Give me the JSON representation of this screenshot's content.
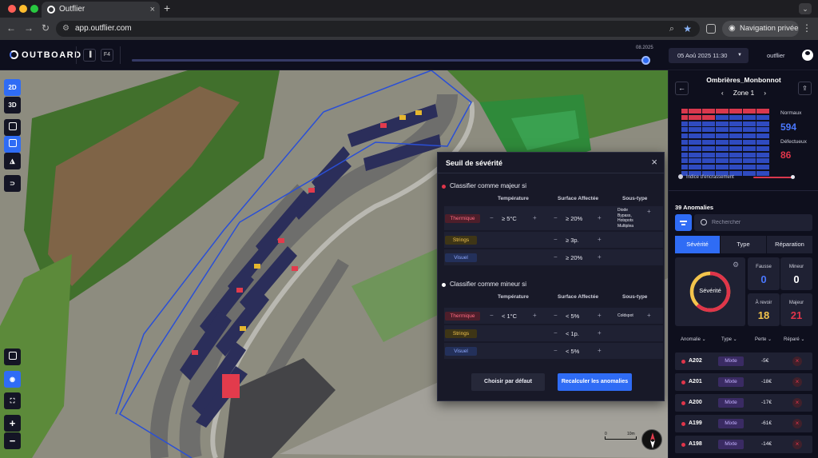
{
  "browser": {
    "tab_title": "Outflier",
    "url": "app.outflier.com",
    "private_label": "Navigation privée",
    "colors": {
      "red": "#ff5f57",
      "yellow": "#febc2e",
      "green": "#28c840"
    }
  },
  "header": {
    "brand": "OUTBOARD",
    "icon_b_label": "F4",
    "timeline_label": "08.2025",
    "timeline_progress": 1.0,
    "date": "05 Aoû 2025 11:30",
    "user": "outflier"
  },
  "left_tools": [
    {
      "label": "2D",
      "icon": "2d-view-icon",
      "active": true
    },
    {
      "label": "3D",
      "icon": "3d-view-icon",
      "active": false
    },
    {
      "label": "",
      "icon": "layers-icon",
      "active": false
    },
    {
      "label": "",
      "icon": "grid-icon",
      "active": true
    },
    {
      "label": "",
      "icon": "drone-icon",
      "active": false
    },
    {
      "label": "",
      "icon": "path-icon",
      "active": false
    }
  ],
  "left_tools_bottom": [
    {
      "label": "",
      "icon": "panel-icon",
      "active": false
    },
    {
      "label": "",
      "icon": "eye-icon",
      "active": true
    },
    {
      "label": "",
      "icon": "fullscreen-icon",
      "active": false
    },
    {
      "label": "+",
      "icon": "zoom-in-icon",
      "active": false
    },
    {
      "label": "−",
      "icon": "zoom-out-icon",
      "active": false
    }
  ],
  "modal": {
    "title": "Seuil de sévérité",
    "major": {
      "title": "Classifier comme majeur si",
      "headers": {
        "temp": "Température",
        "surface": "Surface Affectée",
        "subtype": "Sous-type"
      },
      "rows": [
        {
          "tag": "Thermique",
          "kind": "thermique",
          "temp": "≥ 5°C",
          "surface": "≥ 20%",
          "subtype": "Diode\nBypass,\nHotspots\nMultiplea"
        },
        {
          "tag": "Strings",
          "kind": "strings",
          "temp": "",
          "surface": "≥ 3p.",
          "subtype": ""
        },
        {
          "tag": "Visuel",
          "kind": "visuel",
          "temp": "",
          "surface": "≥ 20%",
          "subtype": ""
        }
      ]
    },
    "minor": {
      "title": "Classifier comme mineur si",
      "headers": {
        "temp": "Température",
        "surface": "Surface Affectée",
        "subtype": "Sous-type"
      },
      "rows": [
        {
          "tag": "Thermique",
          "kind": "thermique",
          "temp": "< 1°C",
          "surface": "< 5%",
          "subtype": "Coldspot"
        },
        {
          "tag": "Strings",
          "kind": "strings",
          "temp": "",
          "surface": "< 1p.",
          "subtype": ""
        },
        {
          "tag": "Visuel",
          "kind": "visuel",
          "temp": "",
          "surface": "< 5%",
          "subtype": ""
        }
      ]
    },
    "btn_default": "Choisir par défaut",
    "btn_recalc": "Recalculer les anomalies",
    "colors": {
      "major": "#e0354a",
      "minor": "#ffffff"
    }
  },
  "panel": {
    "site": "Ombrières_Monbonnot",
    "zone": "Zone 1",
    "normal_label": "Normaux",
    "normal_value": "594",
    "defect_label": "Défectueux",
    "defect_value": "86",
    "soiling_label": "Indice d'encrassement",
    "soiling_level": 0.9,
    "anomaly_count": "39 Anomalies",
    "search_placeholder": "Rechercher",
    "tabs": [
      "Sévérité",
      "Type",
      "Réparation"
    ],
    "active_tab": 0,
    "gauge_label": "Sévérité",
    "gauge_major_fraction": 0.62,
    "stats": [
      {
        "label": "Fausse",
        "value": "0",
        "color": "#4a78ff"
      },
      {
        "label": "Mineur",
        "value": "0",
        "color": "#ffffff"
      },
      {
        "label": "À revoir",
        "value": "18",
        "color": "#f3c44c"
      },
      {
        "label": "Majeur",
        "value": "21",
        "color": "#e0354a"
      }
    ],
    "table_headers": [
      "Anomalie",
      "Type",
      "Perte",
      "Réparé"
    ],
    "rows": [
      {
        "id": "A202",
        "type": "Mixte",
        "perte": "-5€"
      },
      {
        "id": "A201",
        "type": "Mixte",
        "perte": "-18€"
      },
      {
        "id": "A200",
        "type": "Mixte",
        "perte": "-17€"
      },
      {
        "id": "A199",
        "type": "Mixte",
        "perte": "-61€"
      },
      {
        "id": "A198",
        "type": "Mixte",
        "perte": "-14€"
      }
    ],
    "colors": {
      "normal": "#2f4bc0",
      "defect": "#d9384d"
    }
  },
  "map": {
    "scale_start": "0",
    "scale_end": "10m"
  }
}
